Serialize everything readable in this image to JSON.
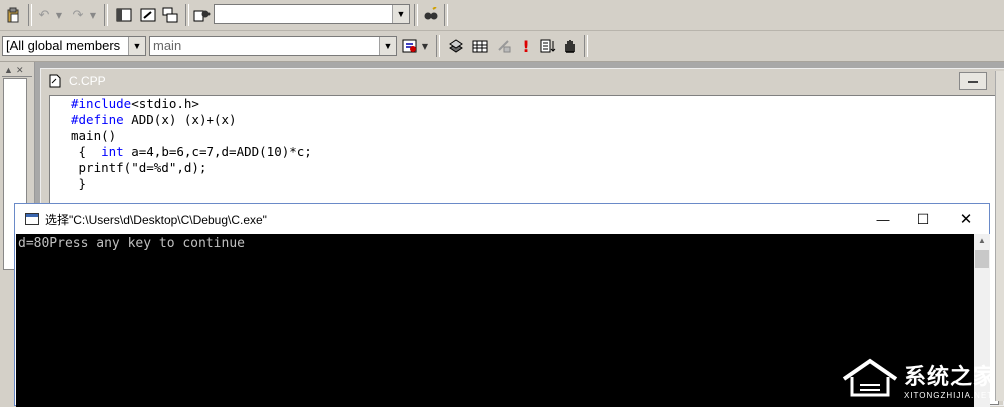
{
  "toolbar1": {
    "find_combo_value": ""
  },
  "toolbar2": {
    "class_combo": "[All global members",
    "member_combo": "main"
  },
  "editor": {
    "title": "C.CPP",
    "code": {
      "line1_kw": "#include",
      "line1_rest": "<stdio.h>",
      "line2_kw": "#define",
      "line2_rest": " ADD(x) (x)+(x)",
      "line3": "main()",
      "line4_open": " {  ",
      "line4_kw": "int",
      "line4_rest": " a=4,b=6,c=7,d=ADD(10)*c;",
      "line5": " printf(\"d=%d\",d);",
      "line6": " }"
    }
  },
  "console": {
    "title": "选择\"C:\\Users\\d\\Desktop\\C\\Debug\\C.exe\"",
    "output": "d=80Press any key to continue",
    "minimize_glyph": "—",
    "maximize_glyph": "☐",
    "close_glyph": "✕"
  },
  "watermark": {
    "text": "系统之家",
    "subtext": "XITONGZHIJIA.NET"
  },
  "colors": {
    "keyword": "#0000ff",
    "console_bg": "#000000",
    "console_text": "#c0c0c0",
    "chrome": "#d4d0c8"
  }
}
